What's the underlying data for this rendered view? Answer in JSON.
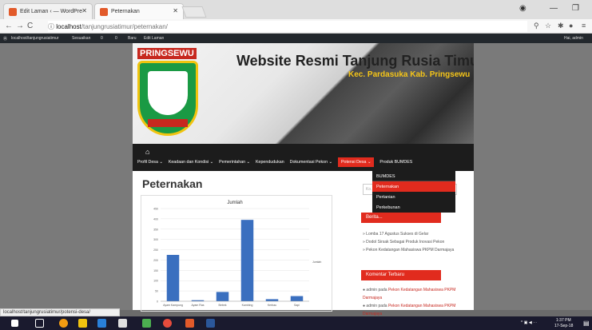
{
  "browser": {
    "tabs": [
      {
        "title": "Edit Laman ‹ — WordPre"
      },
      {
        "title": "Peternakan"
      }
    ],
    "url_host": "localhost",
    "url_path": "/tanjungrusiatimur/peternakan/"
  },
  "wp_admin_bar": {
    "site": "localhost/tanjungrusiatimur",
    "customize": "Sesuaikan",
    "comments": "0",
    "updates": "0",
    "new": "Baru",
    "edit": "Edit Laman",
    "user": "Hai, admin"
  },
  "header": {
    "brand": "PRINGSEWU",
    "title": "Website Resmi Tanjung Rusia Timur",
    "subtitle": "Kec. Pardasuka Kab. Pringsewu"
  },
  "nav": {
    "items": [
      "Profil Desa ⌄",
      "Keadaan dan Kondisi ⌄",
      "Pemerintahan ⌄",
      "Kependudukan",
      "Dokumentasi Pekon ⌄",
      "Potensi Desa ⌄",
      "Produk BUMDES"
    ],
    "active": "Potensi Desa ⌄",
    "dropdown": [
      "BUMDES",
      "Peternakan",
      "Pertanian",
      "Perkebunan"
    ],
    "dropdown_highlight": "Peternakan"
  },
  "page": {
    "heading": "Peternakan"
  },
  "chart_data": {
    "type": "bar",
    "title": "Jumlah",
    "categories": [
      "Ayam Kampung",
      "Ayam Ras",
      "Bebek",
      "Kambing",
      "Kerbau",
      "Sapi"
    ],
    "series": [
      {
        "name": "Jumlah",
        "values": [
          225,
          5,
          45,
          395,
          10,
          25
        ],
        "color": "#3a6fbf"
      }
    ],
    "ylim": [
      0,
      450
    ],
    "yticks": [
      0,
      50,
      100,
      150,
      200,
      250,
      300,
      350,
      400,
      450
    ],
    "legend": "right"
  },
  "sidebar": {
    "search_placeholder": "Ko...",
    "recent_heading": "Berita...",
    "recent": [
      "Lomba 17 Agustus Sukses di Gelar",
      "Dodol Sirsak Sebagai Produk Inovasi Pekon",
      "Pekon Kedatangan Mahasiswa PKPM Darmajaya"
    ],
    "comments_heading": "Komentar Terbaru",
    "comments": [
      {
        "author": "admin",
        "on": "pada",
        "post": "Pekon Kedatangan Mahasiswa PKPM Darmajaya"
      },
      {
        "author": "admin",
        "on": "pada",
        "post": "Pekon Kedatangan Mahasiswa PKPM Darmajaya"
      }
    ]
  },
  "status_bar": "localhost/tanjungrusiatimur/potensi-desa/",
  "taskbar": {
    "time": "1:37 PM",
    "date": "17-Sep-18"
  }
}
